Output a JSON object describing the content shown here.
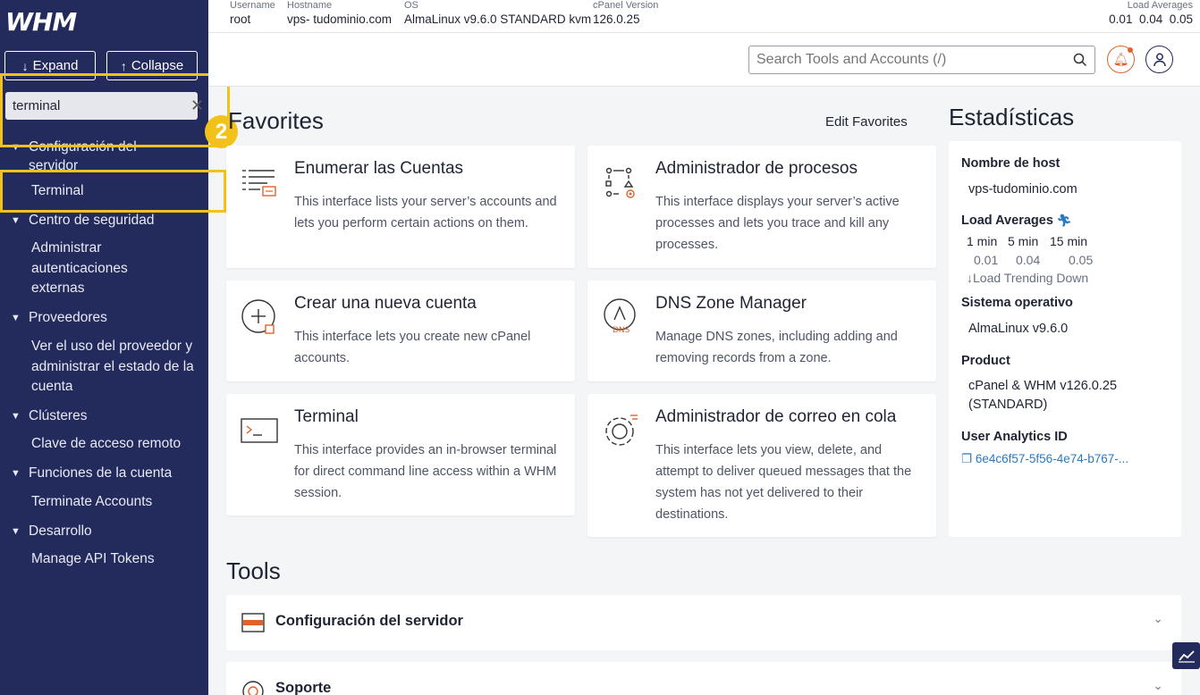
{
  "brand": {
    "logo_text": "WHM"
  },
  "sidebar": {
    "expand_label": "Expand",
    "collapse_label": "Collapse",
    "search_value": "terminal",
    "step_badge": "2",
    "groups": [
      {
        "label": "Configuración del servidor",
        "items": [
          "Terminal"
        ]
      },
      {
        "label": "Centro de seguridad",
        "items": [
          "Administrar autenticaciones externas"
        ]
      },
      {
        "label": "Proveedores",
        "items": [
          "Ver el uso del proveedor y administrar el estado de la cuenta"
        ]
      },
      {
        "label": "Clústeres",
        "items": [
          "Clave de acceso remoto"
        ]
      },
      {
        "label": "Funciones de la cuenta",
        "items": [
          "Terminate Accounts"
        ]
      },
      {
        "label": "Desarrollo",
        "items": [
          "Manage API Tokens"
        ]
      }
    ]
  },
  "topbar": {
    "username": {
      "label": "Username",
      "value": "root"
    },
    "hostname": {
      "label": "Hostname",
      "value": "vps- tudominio.com"
    },
    "os": {
      "label": "OS",
      "value": "AlmaLinux v9.6.0 STANDARD kvm"
    },
    "cpanel": {
      "label": "cPanel Version",
      "value": "126.0.25"
    },
    "load": {
      "label": "Load Averages",
      "value": "0.01  0.04  0.05"
    }
  },
  "header": {
    "search_placeholder": "Search Tools and Accounts (/)"
  },
  "favorites": {
    "title": "Favorites",
    "edit_label": "Edit Favorites",
    "cards": [
      {
        "title": "Enumerar las Cuentas",
        "desc": "This interface lists your server’s accounts and lets you perform certain actions on them."
      },
      {
        "title": "Administrador de procesos",
        "desc": "This interface displays your server’s active processes and lets you trace and kill any processes."
      },
      {
        "title": "Crear una nueva cuenta",
        "desc": "This interface lets you create new cPanel accounts."
      },
      {
        "title": "DNS Zone Manager",
        "desc": "Manage DNS zones, including adding and removing records from a zone."
      },
      {
        "title": "Terminal",
        "desc": "This interface provides an in-browser terminal for direct command line access within a WHM session."
      },
      {
        "title": "Administrador de correo en cola",
        "desc": "This interface lets you view, delete, and attempt to deliver queued messages that the system has not yet delivered to their destinations."
      }
    ]
  },
  "stats": {
    "title": "Estadísticas",
    "hostname_label": "Nombre de host",
    "hostname_value": "vps-tudominio.com",
    "load_label": "Load Averages",
    "load_headers": [
      "1 min",
      "5 min",
      "15 min"
    ],
    "load_values": [
      "0.01",
      "0.04",
      "0.05"
    ],
    "trend": "Load Trending Down",
    "os_label": "Sistema operativo",
    "os_value": "AlmaLinux v9.6.0",
    "product_label": "Product",
    "product_value": "cPanel & WHM v126.0.25 (STANDARD)",
    "uid_label": "User Analytics ID",
    "uid_value": "6e4c6f57-5f56-4e74-b767-..."
  },
  "tools": {
    "title": "Tools",
    "rows": [
      "Configuración del servidor",
      "Soporte"
    ]
  },
  "colors": {
    "sidebar": "#232a5c",
    "highlight": "#f2c21b",
    "accent": "#e0622d",
    "link": "#2a7ac0"
  }
}
